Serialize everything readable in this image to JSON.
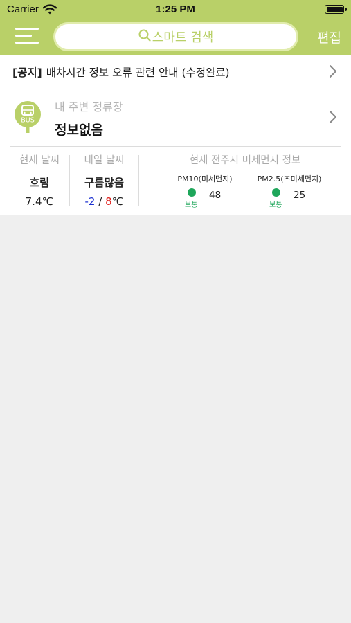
{
  "status_bar": {
    "carrier": "Carrier",
    "time": "1:25 PM"
  },
  "header": {
    "search_label": "스마트 검색",
    "edit_label": "편집"
  },
  "notice": {
    "tag": "[공지]",
    "text": "배차시간 정보 오류 관련 안내 (수정완료)"
  },
  "nearby_stop": {
    "icon_text": "BUS",
    "label": "내 주변 정류장",
    "value": "정보없음"
  },
  "weather": {
    "current": {
      "heading": "현재 날씨",
      "condition": "흐림",
      "temp": "7.4℃"
    },
    "tomorrow": {
      "heading": "내일 날씨",
      "condition": "구름많음",
      "temp_min": "-2",
      "separator": " / ",
      "temp_max": "8",
      "unit": "℃"
    },
    "dust": {
      "heading": "현재 전주시 미세먼지 정보",
      "pm10": {
        "label": "PM10(미세먼지)",
        "grade": "보통",
        "value": "48"
      },
      "pm25": {
        "label": "PM2.5(초미세먼지)",
        "grade": "보통",
        "value": "25"
      }
    }
  },
  "colors": {
    "brand": "#b9d068",
    "search_border": "#e1ecad",
    "grade_normal": "#1ea65a",
    "temp_min": "#1a2fd0",
    "temp_max": "#e0231f",
    "background": "#efefef"
  },
  "icons": [
    "wifi-icon",
    "battery-icon",
    "menu-icon",
    "search-icon",
    "chevron-right-icon",
    "bus-stop-icon"
  ]
}
